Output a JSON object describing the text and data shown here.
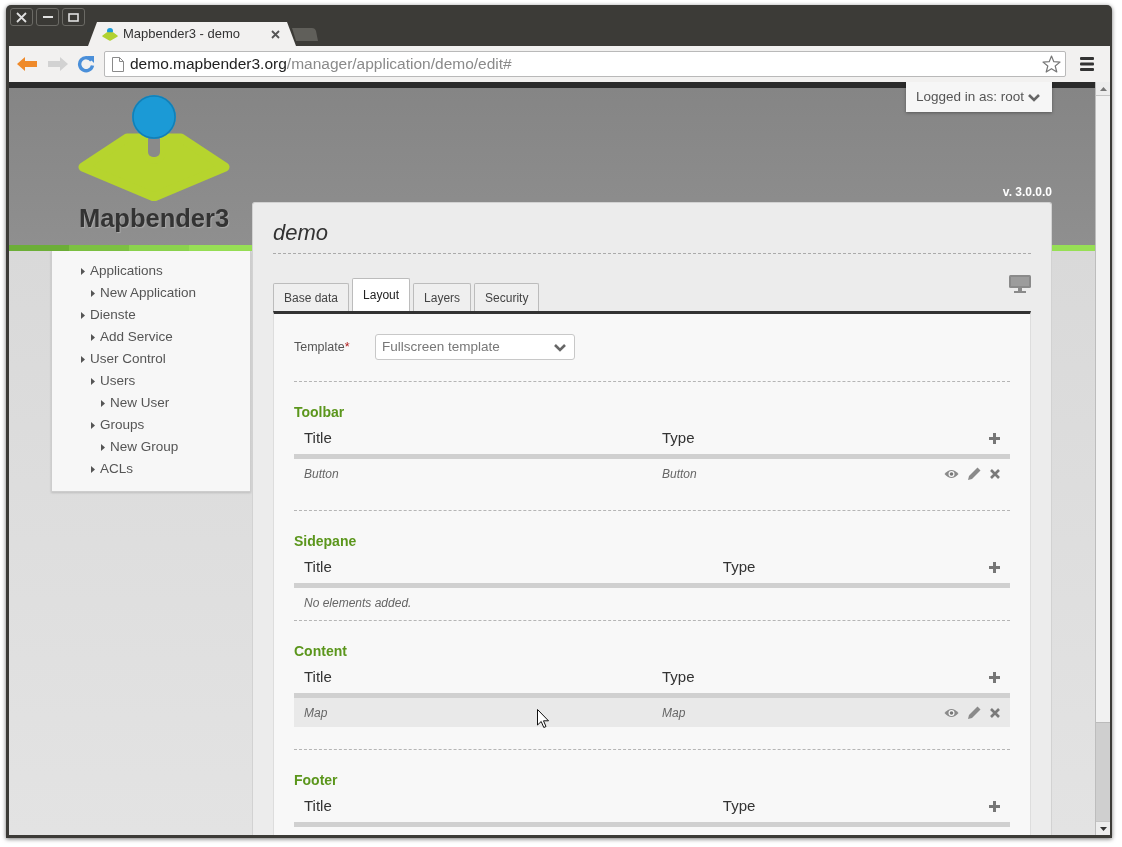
{
  "browser": {
    "tabs": [
      {
        "title": "Mapbender3 - demo"
      }
    ],
    "address": {
      "host": "demo.mapbender3.org",
      "path": "/manager/application/demo/edit#"
    }
  },
  "header": {
    "user_menu": "Logged in as: root",
    "logo_text": "Mapbender3",
    "version": "v. 3.0.0.0"
  },
  "sidebar": {
    "items": [
      {
        "label": "Applications",
        "children": [
          {
            "label": "New Application"
          }
        ]
      },
      {
        "label": "Dienste",
        "children": [
          {
            "label": "Add Service"
          }
        ]
      },
      {
        "label": "User Control",
        "children": [
          {
            "label": "Users",
            "children": [
              {
                "label": "New User"
              }
            ]
          },
          {
            "label": "Groups",
            "children": [
              {
                "label": "New Group"
              }
            ]
          },
          {
            "label": "ACLs"
          }
        ]
      }
    ]
  },
  "page": {
    "title": "demo",
    "tabs": [
      {
        "label": "Base data",
        "selected": false
      },
      {
        "label": "Layout",
        "selected": true
      },
      {
        "label": "Layers",
        "selected": false
      },
      {
        "label": "Security",
        "selected": false
      }
    ],
    "template": {
      "label": "Template",
      "required_mark": "*",
      "value": "Fullscreen template"
    }
  },
  "sections": [
    {
      "title": "Toolbar",
      "columns": [
        "Title",
        "Type"
      ],
      "rows": [
        {
          "title": "Button",
          "type": "Button",
          "hovered": false
        }
      ]
    },
    {
      "title": "Sidepane",
      "columns": [
        "Title",
        "Type"
      ],
      "empty_text": "No elements added."
    },
    {
      "title": "Content",
      "columns": [
        "Title",
        "Type"
      ],
      "rows": [
        {
          "title": "Map",
          "type": "Map",
          "hovered": true
        }
      ]
    },
    {
      "title": "Footer",
      "columns": [
        "Title",
        "Type"
      ]
    }
  ]
}
